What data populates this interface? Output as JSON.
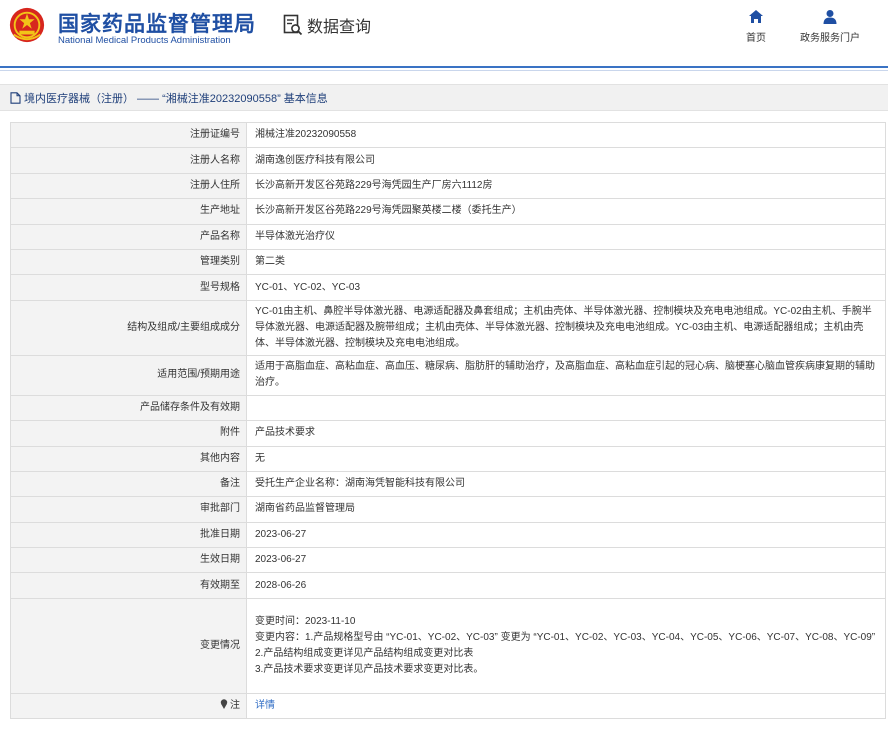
{
  "header": {
    "brand_cn": "国家药品监督管理局",
    "brand_en": "National Medical Products Administration",
    "query_label": "数据查询",
    "nav": [
      {
        "label": "首页",
        "icon": "home-icon"
      },
      {
        "label": "政务服务门户",
        "icon": "user-icon"
      }
    ]
  },
  "breadcrumb": {
    "text": "境内医疗器械（注册） ——  “湘械注准20232090558”  基本信息",
    "icon": "document-icon"
  },
  "colors": {
    "brand_blue": "#1f4fa3",
    "header_rule": "#3a73c4",
    "label_bg": "#f3f3f3",
    "link": "#2f6cc4"
  },
  "rows": {
    "reg_no": {
      "label": "注册证编号",
      "value": "湘械注准20232090558"
    },
    "registrant": {
      "label": "注册人名称",
      "value": "湖南逸创医疗科技有限公司"
    },
    "registrant_address": {
      "label": "注册人住所",
      "value": "长沙高新开发区谷苑路229号海凭园生产厂房六1112房"
    },
    "production_address": {
      "label": "生产地址",
      "value": "长沙高新开发区谷苑路229号海凭园聚英楼二楼（委托生产）"
    },
    "product_name": {
      "label": "产品名称",
      "value": "半导体激光治疗仪"
    },
    "mgmt_class": {
      "label": "管理类别",
      "value": "第二类"
    },
    "model": {
      "label": "型号规格",
      "value": "YC-01、YC-02、YC-03"
    },
    "structure": {
      "label": "结构及组成/主要组成成分",
      "value": "YC-01由主机、鼻腔半导体激光器、电源适配器及鼻套组成；主机由壳体、半导体激光器、控制模块及充电电池组成。YC-02由主机、手腕半导体激光器、电源适配器及腕带组成；主机由壳体、半导体激光器、控制模块及充电电池组成。YC-03由主机、电源适配器组成；主机由壳体、半导体激光器、控制模块及充电电池组成。"
    },
    "scope": {
      "label": "适用范围/预期用途",
      "value": "适用于高脂血症、高粘血症、高血压、糖尿病、脂肪肝的辅助治疗，及高脂血症、高粘血症引起的冠心病、脑梗塞心脑血管疾病康复期的辅助治疗。"
    },
    "storage": {
      "label": "产品储存条件及有效期",
      "value": ""
    },
    "attachment": {
      "label": "附件",
      "value": "产品技术要求"
    },
    "other": {
      "label": "其他内容",
      "value": "无"
    },
    "remark": {
      "label": "备注",
      "value": "受托生产企业名称：湖南海凭智能科技有限公司"
    },
    "approval_dept": {
      "label": "审批部门",
      "value": "湖南省药品监督管理局"
    },
    "approval_date": {
      "label": "批准日期",
      "value": "2023-06-27"
    },
    "effective_date": {
      "label": "生效日期",
      "value": "2023-06-27"
    },
    "expiry_date": {
      "label": "有效期至",
      "value": "2028-06-26"
    },
    "change": {
      "label": "变更情况",
      "lines": [
        "变更时间：2023-11-10",
        "变更内容：1.产品规格型号由 “YC-01、YC-02、YC-03” 变更为 “YC-01、YC-02、YC-03、YC-04、YC-05、YC-06、YC-07、YC-08、YC-09”",
        "2.产品结构组成变更详见产品结构组成变更对比表",
        "3.产品技术要求变更详见产品技术要求变更对比表。"
      ]
    },
    "note": {
      "label": "注",
      "value": "详情",
      "icon": "pin-icon"
    }
  }
}
